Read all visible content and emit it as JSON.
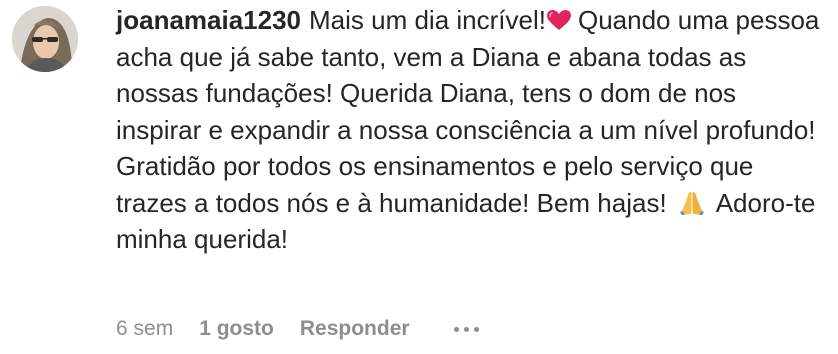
{
  "comment": {
    "username": "joanamaia1230",
    "text_1": "Mais um dia incrível!",
    "text_2": "Quando uma pessoa acha que já sabe tanto, vem a Diana e abana todas as nossas fundações! Querida Diana, tens o dom de nos inspirar e expandir a nossa consciência a um nível profundo! Gratidão por todos os ensinamentos e pelo serviço que trazes a todos nós e à humanidade! Bem hajas!",
    "text_3": "Adoro-te minha querida!",
    "emoji_1": "heart-icon",
    "emoji_2": "folded-hands-icon"
  },
  "meta": {
    "time": "6 sem",
    "likes": "1 gosto",
    "reply": "Responder",
    "more_icon": "ellipsis-icon"
  },
  "colors": {
    "text": "#262626",
    "secondary": "#8e8e8e",
    "heart": "#e0245e",
    "background": "#ffffff"
  }
}
